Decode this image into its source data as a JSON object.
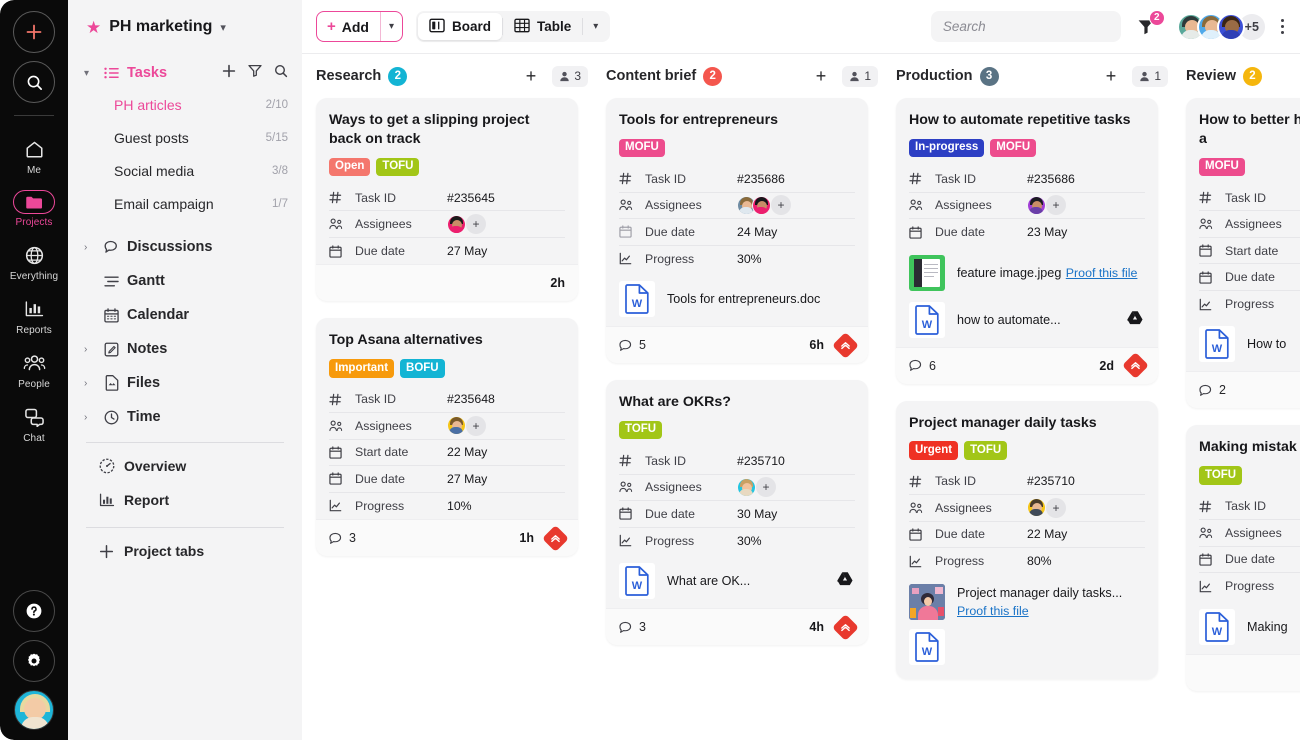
{
  "rail": {
    "add_icon": "plus-icon",
    "search_icon": "search-icon",
    "items": [
      {
        "label": "Me",
        "icon": "home-icon",
        "active": false
      },
      {
        "label": "Projects",
        "icon": "folder-icon",
        "active": true
      },
      {
        "label": "Everything",
        "icon": "globe-icon",
        "active": false
      },
      {
        "label": "Reports",
        "icon": "bar-chart-icon",
        "active": false
      },
      {
        "label": "People",
        "icon": "people-icon",
        "active": false
      },
      {
        "label": "Chat",
        "icon": "chat-icon",
        "active": false
      }
    ],
    "help_icon": "question-mark-icon",
    "settings_icon": "gear-icon",
    "avatar": "user-avatar"
  },
  "sidebar": {
    "project_name": "PH marketing",
    "star_icon": "star-icon",
    "caret_icon": "chevron-down-icon",
    "tasks": {
      "label": "Tasks",
      "icon": "task-list-icon",
      "actions": [
        "plus-icon",
        "filter-icon",
        "search-icon"
      ],
      "items": [
        {
          "label": "PH articles",
          "count": "2/10",
          "active": true
        },
        {
          "label": "Guest posts",
          "count": "5/15",
          "active": false
        },
        {
          "label": "Social media",
          "count": "3/8",
          "active": false
        },
        {
          "label": "Email campaign",
          "count": "1/7",
          "active": false
        }
      ]
    },
    "groups": [
      {
        "label": "Discussions",
        "icon": "chat-bubble-icon",
        "expandable": true
      },
      {
        "label": "Gantt",
        "icon": "gantt-icon",
        "expandable": false
      },
      {
        "label": "Calendar",
        "icon": "calendar-icon",
        "expandable": false
      },
      {
        "label": "Notes",
        "icon": "note-icon",
        "expandable": true
      },
      {
        "label": "Files",
        "icon": "file-icon",
        "expandable": true
      },
      {
        "label": "Time",
        "icon": "clock-icon",
        "expandable": true
      }
    ],
    "links": [
      {
        "label": "Overview",
        "icon": "dashboard-icon"
      },
      {
        "label": "Report",
        "icon": "bar-chart-icon"
      }
    ],
    "project_tabs": {
      "label": "Project tabs",
      "icon": "plus-icon"
    }
  },
  "topbar": {
    "add_label": "Add",
    "add_plus": "+",
    "views": [
      {
        "label": "Board",
        "icon": "board-icon",
        "selected": true
      },
      {
        "label": "Table",
        "icon": "table-icon",
        "selected": false
      }
    ],
    "search_placeholder": "Search",
    "search_value": "",
    "filter_icon": "filter-icon",
    "filter_badge": "2",
    "avatar_overflow": "+5",
    "kebab_icon": "more-vertical-icon"
  },
  "board": {
    "columns": [
      {
        "title": "Research",
        "badge": "2",
        "badge_color": "#13b4d4",
        "people_count": "3",
        "cards": [
          {
            "title": "Ways to get a slipping project back on track",
            "tags": [
              {
                "label": "Open",
                "color": "#f4776d"
              },
              {
                "label": "TOFU",
                "color": "#a2c617"
              }
            ],
            "fields": [
              {
                "icon": "hash-icon",
                "label": "Task ID",
                "value": "#235645"
              },
              {
                "icon": "people-icon",
                "label": "Assignees",
                "value": "",
                "avatars": [
                  {
                    "hair": "#1a1a1a",
                    "body": "#ec1f6e",
                    "skin": "#c98d67"
                  }
                ],
                "add": true
              },
              {
                "icon": "calendar-icon",
                "label": "Due date",
                "value": "27 May"
              }
            ],
            "attachments": [],
            "footer": {
              "comments": "",
              "time": "2h",
              "priority": false
            }
          },
          {
            "title": "Top Asana alternatives",
            "tags": [
              {
                "label": "Important",
                "color": "#f79a0c"
              },
              {
                "label": "BOFU",
                "color": "#13b4d4"
              }
            ],
            "fields": [
              {
                "icon": "hash-icon",
                "label": "Task ID",
                "value": "#235648"
              },
              {
                "icon": "people-icon",
                "label": "Assignees",
                "value": "",
                "avatars": [
                  {
                    "hair": "#7a5a2a",
                    "body": "#f5c518",
                    "skin": "#e8b893"
                  }
                ],
                "add": true
              },
              {
                "icon": "calendar-icon",
                "label": "Start date",
                "value": "22 May"
              },
              {
                "icon": "calendar-icon",
                "label": "Due date",
                "value": "27 May"
              },
              {
                "icon": "progress-icon",
                "label": "Progress",
                "value": "10%"
              }
            ],
            "attachments": [],
            "footer": {
              "comments": "3",
              "time": "1h",
              "priority": true
            }
          }
        ]
      },
      {
        "title": "Content brief",
        "badge": "2",
        "badge_color": "#f4564d",
        "people_count": "1",
        "cards": [
          {
            "title": "Tools for entrepreneurs",
            "tags": [
              {
                "label": "MOFU",
                "color": "#ed4c8d"
              }
            ],
            "fields": [
              {
                "icon": "hash-icon",
                "label": "Task ID",
                "value": "#235686"
              },
              {
                "icon": "people-icon",
                "label": "Assignees",
                "value": "",
                "avatars": [
                  {
                    "hair": "#8a6a3a",
                    "body": "#6f8ca3",
                    "skin": "#e8b893"
                  },
                  {
                    "hair": "#16161a",
                    "body": "#ec1f6e",
                    "skin": "#c98d67"
                  }
                ],
                "add": true
              },
              {
                "icon": "calendar-icon",
                "label": "Due date",
                "value": "24 May"
              },
              {
                "icon": "progress-icon",
                "label": "Progress",
                "value": "30%"
              }
            ],
            "attachments": [
              {
                "type": "doc",
                "name": "Tools for entrepreneurs.doc",
                "proof": "",
                "gdrive": false
              }
            ],
            "footer": {
              "comments": "5",
              "time": "6h",
              "priority": true
            }
          },
          {
            "title": "What are OKRs?",
            "tags": [
              {
                "label": "TOFU",
                "color": "#a2c617"
              }
            ],
            "fields": [
              {
                "icon": "hash-icon",
                "label": "Task ID",
                "value": "#235710"
              },
              {
                "icon": "people-icon",
                "label": "Assignees",
                "value": "",
                "avatars": [
                  {
                    "hair": "#c9a063",
                    "body": "#23c5e0",
                    "skin": "#f0c39d"
                  }
                ],
                "add": true
              },
              {
                "icon": "calendar-icon",
                "label": "Due date",
                "value": "30 May"
              },
              {
                "icon": "progress-icon",
                "label": "Progress",
                "value": "30%"
              }
            ],
            "attachments": [
              {
                "type": "doc",
                "name": "What are OK...",
                "proof": "",
                "gdrive": true
              }
            ],
            "footer": {
              "comments": "3",
              "time": "4h",
              "priority": true
            }
          }
        ]
      },
      {
        "title": "Production",
        "badge": "3",
        "badge_color": "#5a7384",
        "people_count": "1",
        "cards": [
          {
            "title": "How to automate repetitive tasks",
            "tags": [
              {
                "label": "In-progress",
                "color": "#2d3fc4"
              },
              {
                "label": "MOFU",
                "color": "#ed4c8d"
              }
            ],
            "fields": [
              {
                "icon": "hash-icon",
                "label": "Task ID",
                "value": "#235686"
              },
              {
                "icon": "people-icon",
                "label": "Assignees",
                "value": "",
                "avatars": [
                  {
                    "hair": "#1b1b22",
                    "body": "#a23fd6",
                    "skin": "#c98d67"
                  }
                ],
                "add": true
              },
              {
                "icon": "calendar-icon",
                "label": "Due date",
                "value": "23 May"
              }
            ],
            "attachments": [
              {
                "type": "image",
                "name": "feature image.jpeg",
                "proof": "Proof this file",
                "gdrive": false,
                "thumb": "#3fc45c"
              },
              {
                "type": "doc",
                "name": "how to automate...",
                "proof": "",
                "gdrive": true
              }
            ],
            "footer": {
              "comments": "6",
              "time": "2d",
              "priority": true
            }
          },
          {
            "title": "Project manager daily tasks",
            "tags": [
              {
                "label": "Urgent",
                "color": "#ef3124"
              },
              {
                "label": "TOFU",
                "color": "#a2c617"
              }
            ],
            "fields": [
              {
                "icon": "hash-icon",
                "label": "Task ID",
                "value": "#235710"
              },
              {
                "icon": "people-icon",
                "label": "Assignees",
                "value": "",
                "avatars": [
                  {
                    "hair": "#4a3c2a",
                    "body": "#f5c518",
                    "skin": "#e8b893"
                  }
                ],
                "add": true
              },
              {
                "icon": "calendar-icon",
                "label": "Due date",
                "value": "22 May"
              },
              {
                "icon": "progress-icon",
                "label": "Progress",
                "value": "80%"
              }
            ],
            "attachments": [
              {
                "type": "image",
                "name": "Project manager daily tasks...",
                "proof": "Proof this file",
                "gdrive": false,
                "thumb": "#e86a9a"
              },
              {
                "type": "doc",
                "name": "",
                "proof": "",
                "gdrive": false
              }
            ],
            "footer": null
          }
        ]
      },
      {
        "title": "Review",
        "badge": "2",
        "badge_color": "#f5b60d",
        "people_count": "",
        "cards": [
          {
            "title": "How to better handle deadlines as a",
            "tags": [
              {
                "label": "MOFU",
                "color": "#ed4c8d"
              }
            ],
            "fields": [
              {
                "icon": "hash-icon",
                "label": "Task ID",
                "value": ""
              },
              {
                "icon": "people-icon",
                "label": "Assignees",
                "value": ""
              },
              {
                "icon": "calendar-icon",
                "label": "Start date",
                "value": ""
              },
              {
                "icon": "calendar-icon",
                "label": "Due date",
                "value": ""
              },
              {
                "icon": "progress-icon",
                "label": "Progress",
                "value": ""
              }
            ],
            "attachments": [
              {
                "type": "doc",
                "name": "How to",
                "proof": "",
                "gdrive": false
              }
            ],
            "footer": {
              "comments": "2",
              "time": "",
              "priority": false
            }
          },
          {
            "title": "Making mistak",
            "tags": [
              {
                "label": "TOFU",
                "color": "#a2c617"
              }
            ],
            "fields": [
              {
                "icon": "hash-icon",
                "label": "Task ID",
                "value": ""
              },
              {
                "icon": "people-icon",
                "label": "Assignees",
                "value": ""
              },
              {
                "icon": "calendar-icon",
                "label": "Due date",
                "value": ""
              },
              {
                "icon": "progress-icon",
                "label": "Progress",
                "value": ""
              }
            ],
            "attachments": [
              {
                "type": "doc",
                "name": "Making",
                "proof": "",
                "gdrive": false
              }
            ],
            "footer": {
              "comments": "",
              "time": "",
              "priority": false
            }
          }
        ]
      }
    ]
  }
}
